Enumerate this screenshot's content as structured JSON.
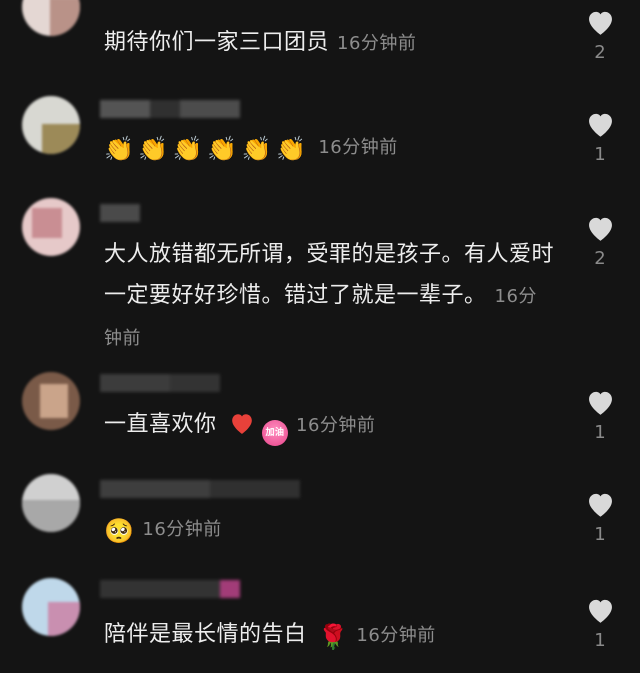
{
  "colors": {
    "background": "#141414",
    "text": "#ededed",
    "meta": "#8d8d8d",
    "heart_icon": "#d9d9d9",
    "red_heart": "#e8413a"
  },
  "comments": [
    {
      "text": "期待你们一家三口团员",
      "time": "16分钟前",
      "likes": "2"
    },
    {
      "emojis": [
        "clapping-hands",
        "clapping-hands",
        "clapping-hands",
        "clapping-hands",
        "clapping-hands",
        "clapping-hands"
      ],
      "time": "16分钟前",
      "likes": "1"
    },
    {
      "text": "大人放错都无所谓，受罪的是孩子。有人爱时一定要好好珍惜。错过了就是一辈子。",
      "time": "16分钟前",
      "likes": "2"
    },
    {
      "text": "一直喜欢你",
      "emojis": [
        "red-heart",
        "jiayou-sticker"
      ],
      "sticker_text": "加油",
      "time": "16分钟前",
      "likes": "1"
    },
    {
      "emojis": [
        "pleading-face"
      ],
      "time": "16分钟前",
      "likes": "1"
    },
    {
      "text": "陪伴是最长情的告白",
      "emojis": [
        "rose"
      ],
      "time": "16分钟前",
      "likes": "1"
    }
  ]
}
